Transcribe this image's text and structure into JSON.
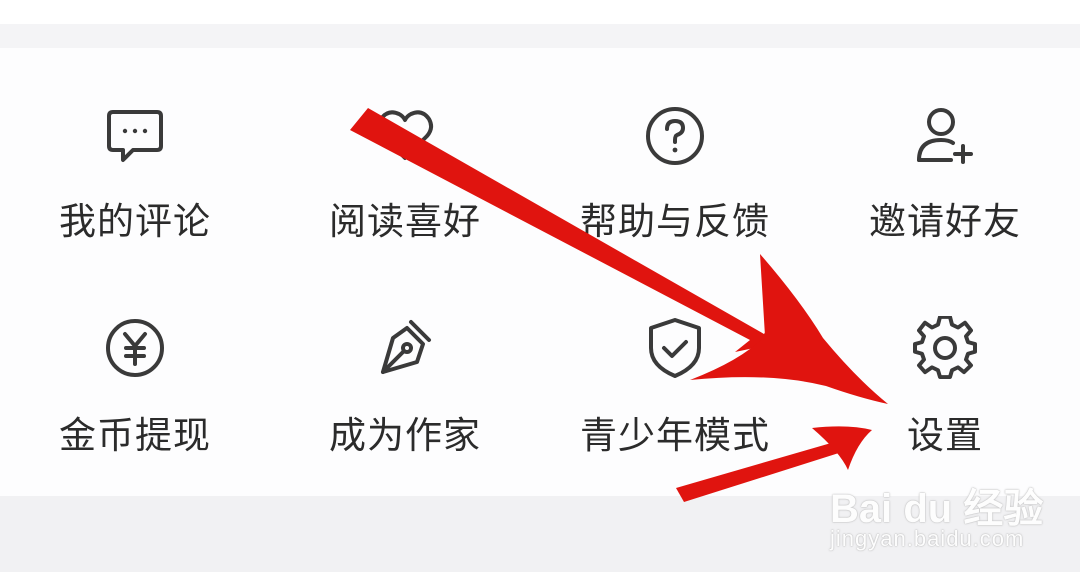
{
  "menu": {
    "items": [
      {
        "label": "我的评论",
        "icon": "comment-icon"
      },
      {
        "label": "阅读喜好",
        "icon": "heart-icon"
      },
      {
        "label": "帮助与反馈",
        "icon": "help-icon"
      },
      {
        "label": "邀请好友",
        "icon": "add-friend-icon"
      },
      {
        "label": "金币提现",
        "icon": "yuan-coin-icon"
      },
      {
        "label": "成为作家",
        "icon": "pen-icon"
      },
      {
        "label": "青少年模式",
        "icon": "shield-check-icon"
      },
      {
        "label": "设置",
        "icon": "gear-icon"
      }
    ]
  },
  "watermark": {
    "brand": "Bai du 经验",
    "url": "jingyan.baidu.com"
  },
  "colors": {
    "icon_stroke": "#3a3a3a",
    "label_text": "#2b2b2b",
    "annotation_arrow": "#e0140f",
    "separator_bg": "#f1f1f3"
  }
}
